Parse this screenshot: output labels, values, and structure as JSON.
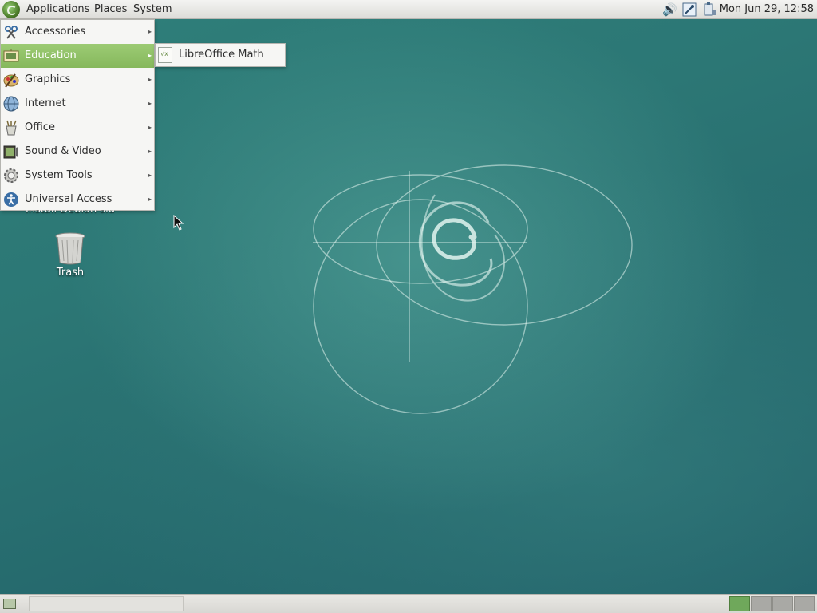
{
  "top_panel": {
    "menus": [
      "Applications",
      "Places",
      "System"
    ],
    "tray_icons": [
      "volume-icon",
      "network-icon",
      "power-icon"
    ],
    "clock": "Mon Jun 29, 12:58"
  },
  "app_menu": {
    "items": [
      {
        "label": "Accessories",
        "icon": "accessories-icon",
        "has_submenu": true
      },
      {
        "label": "Education",
        "icon": "education-icon",
        "has_submenu": true,
        "active": true
      },
      {
        "label": "Graphics",
        "icon": "graphics-icon",
        "has_submenu": true
      },
      {
        "label": "Internet",
        "icon": "internet-icon",
        "has_submenu": true
      },
      {
        "label": "Office",
        "icon": "office-icon",
        "has_submenu": true
      },
      {
        "label": "Sound & Video",
        "icon": "sound-video-icon",
        "has_submenu": true
      },
      {
        "label": "System Tools",
        "icon": "system-tools-icon",
        "has_submenu": true
      },
      {
        "label": "Universal Access",
        "icon": "universal-access-icon",
        "has_submenu": true
      }
    ],
    "arrow": "▸"
  },
  "education_submenu": {
    "items": [
      {
        "label": "LibreOffice Math",
        "icon": "libreoffice-math-icon"
      }
    ]
  },
  "desktop": {
    "icons": [
      {
        "label": "Install Debian sid",
        "partially_hidden": true
      },
      {
        "label": "Trash",
        "icon": "trash-icon"
      }
    ]
  },
  "bottom_panel": {
    "workspaces": [
      {
        "current": true
      },
      {
        "current": false
      },
      {
        "current": false
      },
      {
        "current": false
      }
    ]
  },
  "colors": {
    "accent": "#8fbf66",
    "desktop": "#2c7775"
  }
}
